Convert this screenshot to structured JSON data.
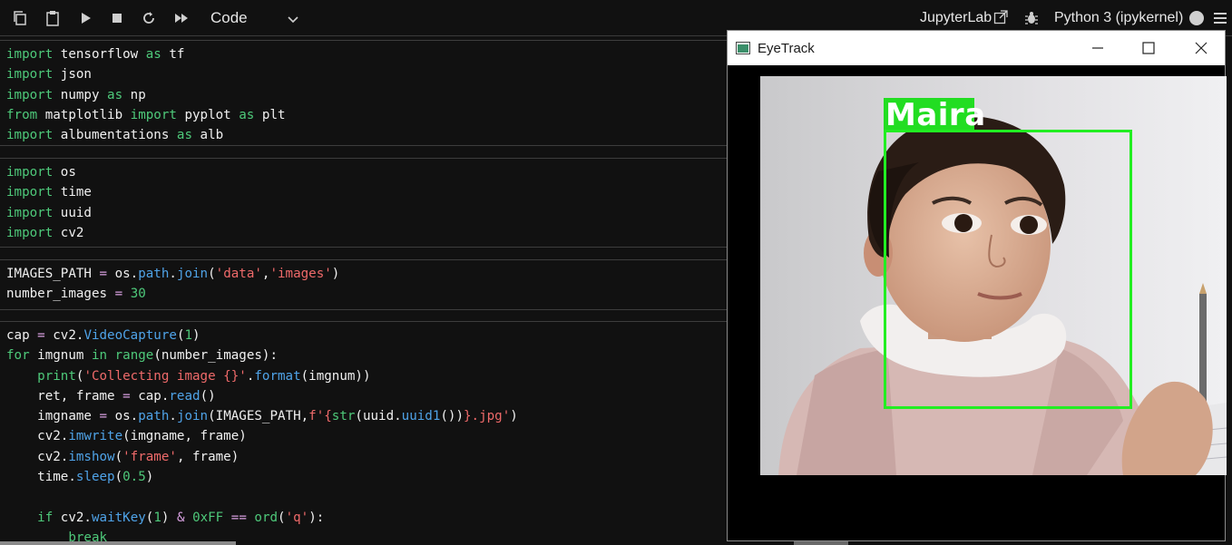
{
  "toolbar": {
    "cell_type": "Code",
    "jupyterlab_label": "JupyterLab",
    "kernel_label": "Python 3 (ipykernel)"
  },
  "cells": [
    [
      [
        [
          "import",
          "kw"
        ],
        [
          " tensorflow ",
          ""
        ],
        [
          "as",
          "kw"
        ],
        [
          " tf",
          ""
        ]
      ],
      [
        [
          "import",
          "kw"
        ],
        [
          " json",
          ""
        ]
      ],
      [
        [
          "import",
          "kw"
        ],
        [
          " numpy ",
          ""
        ],
        [
          "as",
          "kw"
        ],
        [
          " np",
          ""
        ]
      ],
      [
        [
          "from",
          "kw"
        ],
        [
          " matplotlib ",
          ""
        ],
        [
          "import",
          "kw"
        ],
        [
          " pyplot ",
          ""
        ],
        [
          "as",
          "kw"
        ],
        [
          " plt",
          ""
        ]
      ],
      [
        [
          "import",
          "kw"
        ],
        [
          " albumentations ",
          ""
        ],
        [
          "as",
          "kw"
        ],
        [
          " alb",
          ""
        ]
      ]
    ],
    [
      [
        [
          "import",
          "kw"
        ],
        [
          " os",
          ""
        ]
      ],
      [
        [
          "import",
          "kw"
        ],
        [
          " time",
          ""
        ]
      ],
      [
        [
          "import",
          "kw"
        ],
        [
          " uuid",
          ""
        ]
      ],
      [
        [
          "import",
          "kw"
        ],
        [
          " cv2",
          ""
        ]
      ]
    ],
    [
      [
        [
          "IMAGES_PATH ",
          ""
        ],
        [
          "=",
          "op"
        ],
        [
          " os.",
          ""
        ],
        [
          "path",
          "fn"
        ],
        [
          ".",
          ""
        ],
        [
          "join",
          "fn"
        ],
        [
          "(",
          ""
        ],
        [
          "'data'",
          "str"
        ],
        [
          ",",
          ""
        ],
        [
          "'images'",
          "str"
        ],
        [
          ")",
          ""
        ]
      ],
      [
        [
          "number_images ",
          ""
        ],
        [
          "=",
          "op"
        ],
        [
          " ",
          ""
        ],
        [
          "30",
          "num"
        ]
      ]
    ],
    [
      [
        [
          "cap ",
          ""
        ],
        [
          "=",
          "op"
        ],
        [
          " cv2.",
          ""
        ],
        [
          "VideoCapture",
          "fn"
        ],
        [
          "(",
          ""
        ],
        [
          "1",
          "num"
        ],
        [
          ")",
          ""
        ]
      ],
      [
        [
          "for",
          "kw"
        ],
        [
          " imgnum ",
          ""
        ],
        [
          "in",
          "kw"
        ],
        [
          " ",
          ""
        ],
        [
          "range",
          "kw"
        ],
        [
          "(number_images):",
          ""
        ]
      ],
      [
        [
          "    ",
          ""
        ],
        [
          "print",
          "kw"
        ],
        [
          "(",
          ""
        ],
        [
          "'Collecting image {}'",
          "str"
        ],
        [
          ".",
          ""
        ],
        [
          "format",
          "fn"
        ],
        [
          "(imgnum))",
          ""
        ]
      ],
      [
        [
          "    ret, frame ",
          ""
        ],
        [
          "=",
          "op"
        ],
        [
          " cap.",
          ""
        ],
        [
          "read",
          "fn"
        ],
        [
          "()",
          ""
        ]
      ],
      [
        [
          "    imgname ",
          ""
        ],
        [
          "=",
          "op"
        ],
        [
          " os.",
          ""
        ],
        [
          "path",
          "fn"
        ],
        [
          ".",
          ""
        ],
        [
          "join",
          "fn"
        ],
        [
          "(IMAGES_PATH,",
          ""
        ],
        [
          "f'{",
          "str"
        ],
        [
          "str",
          "kw"
        ],
        [
          "(uuid.",
          ""
        ],
        [
          "uuid1",
          "fn"
        ],
        [
          "())",
          ""
        ],
        [
          "}.jpg'",
          "str"
        ],
        [
          ")",
          ""
        ]
      ],
      [
        [
          "    cv2.",
          ""
        ],
        [
          "imwrite",
          "fn"
        ],
        [
          "(imgname, frame)",
          ""
        ]
      ],
      [
        [
          "    cv2.",
          ""
        ],
        [
          "imshow",
          "fn"
        ],
        [
          "(",
          ""
        ],
        [
          "'frame'",
          "str"
        ],
        [
          ", frame)",
          ""
        ]
      ],
      [
        [
          "    time.",
          ""
        ],
        [
          "sleep",
          "fn"
        ],
        [
          "(",
          ""
        ],
        [
          "0.5",
          "num"
        ],
        [
          ")",
          ""
        ]
      ],
      [
        [
          "",
          ""
        ]
      ],
      [
        [
          "    ",
          ""
        ],
        [
          "if",
          "kw"
        ],
        [
          " cv2.",
          ""
        ],
        [
          "waitKey",
          "fn"
        ],
        [
          "(",
          ""
        ],
        [
          "1",
          "num"
        ],
        [
          ") ",
          ""
        ],
        [
          "&",
          "op"
        ],
        [
          " ",
          ""
        ],
        [
          "0xFF",
          "num"
        ],
        [
          " ",
          ""
        ],
        [
          "==",
          "op"
        ],
        [
          " ",
          ""
        ],
        [
          "ord",
          "kw"
        ],
        [
          "(",
          ""
        ],
        [
          "'q'",
          "str"
        ],
        [
          "):",
          ""
        ]
      ],
      [
        [
          "        ",
          ""
        ],
        [
          "break",
          "kw"
        ]
      ]
    ]
  ],
  "window": {
    "title": "EyeTrack",
    "detection_label": "Maira"
  }
}
